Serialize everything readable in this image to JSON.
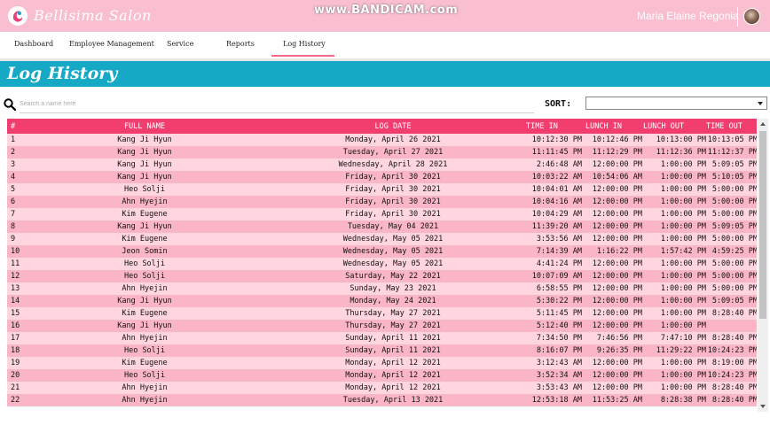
{
  "header": {
    "brand": "Bellisima Salon",
    "watermark": "www.BANDICAM.com",
    "user_name": "Maria Elaine Regonia",
    "accent_color": "#f9bfd0"
  },
  "nav": {
    "items": [
      {
        "label": "Dashboard"
      },
      {
        "label": "Employee Management"
      },
      {
        "label": "Service"
      },
      {
        "label": "Reports"
      },
      {
        "label": "Log History",
        "active": true
      }
    ]
  },
  "page": {
    "title": "Log History"
  },
  "search": {
    "placeholder": "Search a name here",
    "value": ""
  },
  "sort": {
    "label": "SORT:",
    "selected": ""
  },
  "table": {
    "headers": [
      "#",
      "FULL NAME",
      "LOG DATE",
      "TIME IN",
      "LUNCH IN",
      "LUNCH OUT",
      "TIME OUT"
    ],
    "header_color": "#f23e6f",
    "rows": [
      [
        "1",
        "Kang Ji Hyun",
        "Monday, April 26 2021",
        "10:12:30 PM",
        "10:12:46 PM",
        "10:13:00 PM",
        "10:13:05 PM"
      ],
      [
        "2",
        "Kang Ji Hyun",
        "Tuesday, April 27 2021",
        "11:11:45 PM",
        "11:12:29 PM",
        "11:12:36 PM",
        "11:12:37 PM"
      ],
      [
        "3",
        "Kang Ji Hyun",
        "Wednesday, April 28 2021",
        "2:46:48 AM",
        "12:00:00 PM",
        "1:00:00 PM",
        "5:09:05 PM"
      ],
      [
        "4",
        "Kang Ji Hyun",
        "Friday, April 30 2021",
        "10:03:22 AM",
        "10:54:06 AM",
        "1:00:00 PM",
        "5:10:05 PM"
      ],
      [
        "5",
        "Heo Solji",
        "Friday, April 30 2021",
        "10:04:01 AM",
        "12:00:00 PM",
        "1:00:00 PM",
        "5:00:00 PM"
      ],
      [
        "6",
        "Ahn Hyejin",
        "Friday, April 30 2021",
        "10:04:16 AM",
        "12:00:00 PM",
        "1:00:00 PM",
        "5:00:00 PM"
      ],
      [
        "7",
        "Kim Eugene",
        "Friday, April 30 2021",
        "10:04:29 AM",
        "12:00:00 PM",
        "1:00:00 PM",
        "5:00:00 PM"
      ],
      [
        "8",
        "Kang Ji Hyun",
        "Tuesday, May 04 2021",
        "11:39:20 AM",
        "12:00:00 PM",
        "1:00:00 PM",
        "5:09:05 PM"
      ],
      [
        "9",
        "Kim Eugene",
        "Wednesday, May 05 2021",
        "3:53:56 AM",
        "12:00:00 PM",
        "1:00:00 PM",
        "5:00:00 PM"
      ],
      [
        "10",
        "Jeon Somin",
        "Wednesday, May 05 2021",
        "7:14:39 AM",
        "1:16:22 PM",
        "1:57:42 PM",
        "4:59:25 PM"
      ],
      [
        "11",
        "Heo Solji",
        "Wednesday, May 05 2021",
        "4:41:24 PM",
        "12:00:00 PM",
        "1:00:00 PM",
        "5:00:00 PM"
      ],
      [
        "12",
        "Heo Solji",
        "Saturday, May 22 2021",
        "10:07:09 AM",
        "12:00:00 PM",
        "1:00:00 PM",
        "5:00:00 PM"
      ],
      [
        "13",
        "Ahn Hyejin",
        "Sunday, May 23 2021",
        "6:58:55 PM",
        "12:00:00 PM",
        "1:00:00 PM",
        "5:00:00 PM"
      ],
      [
        "14",
        "Kang Ji Hyun",
        "Monday, May 24 2021",
        "5:30:22 PM",
        "12:00:00 PM",
        "1:00:00 PM",
        "5:09:05 PM"
      ],
      [
        "15",
        "Kim Eugene",
        "Thursday, May 27 2021",
        "5:11:45 PM",
        "12:00:00 PM",
        "1:00:00 PM",
        "8:28:40 PM"
      ],
      [
        "16",
        "Kang Ji Hyun",
        "Thursday, May 27 2021",
        "5:12:40 PM",
        "12:00:00 PM",
        "1:00:00 PM",
        ""
      ],
      [
        "17",
        "Ahn Hyejin",
        "Sunday, April 11 2021",
        "7:34:50 PM",
        "7:46:56 PM",
        "7:47:10 PM",
        "8:28:40 PM"
      ],
      [
        "18",
        "Heo Solji",
        "Sunday, April 11 2021",
        "8:16:07 PM",
        "9:26:35 PM",
        "11:29:22 PM",
        "10:24:23 PM"
      ],
      [
        "19",
        "Kim Eugene",
        "Monday, April 12 2021",
        "3:12:43 AM",
        "12:00:00 PM",
        "1:00:00 PM",
        "8:19:00 PM"
      ],
      [
        "20",
        "Heo Solji",
        "Monday, April 12 2021",
        "3:52:34 AM",
        "12:00:00 PM",
        "1:00:00 PM",
        "10:24:23 PM"
      ],
      [
        "21",
        "Ahn Hyejin",
        "Monday, April 12 2021",
        "3:53:43 AM",
        "12:00:00 PM",
        "1:00:00 PM",
        "8:28:40 PM"
      ],
      [
        "22",
        "Ahn Hyejin",
        "Tuesday, April 13 2021",
        "12:53:18 AM",
        "11:53:25 AM",
        "8:28:38 PM",
        "8:28:40 PM"
      ]
    ]
  }
}
